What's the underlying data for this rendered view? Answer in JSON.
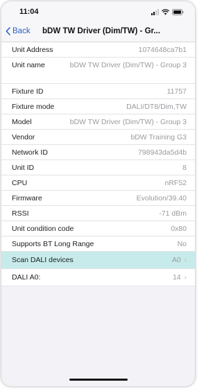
{
  "status": {
    "time": "11:04"
  },
  "nav": {
    "back_label": "Back",
    "title": "bDW TW Driver (Dim/TW) - Gr..."
  },
  "rows": [
    {
      "label": "Unit Address",
      "value": "1074648ca7b1"
    },
    {
      "label": "Unit name",
      "value": "bDW TW Driver (Dim/TW) - Group 3"
    },
    {
      "label": "Fixture ID",
      "value": "11757"
    },
    {
      "label": "Fixture mode",
      "value": "DALI/DT8/Dim,TW"
    },
    {
      "label": "Model",
      "value": "bDW TW Driver (Dim/TW) - Group 3"
    },
    {
      "label": "Vendor",
      "value": "bDW Training G3"
    },
    {
      "label": "Network ID",
      "value": "798943da5d4b"
    },
    {
      "label": "Unit ID",
      "value": "8"
    },
    {
      "label": "CPU",
      "value": "nRF52"
    },
    {
      "label": "Firmware",
      "value": "Evolution/39.40"
    },
    {
      "label": "RSSI",
      "value": "-71 dBm"
    },
    {
      "label": "Unit condition code",
      "value": "0x80"
    },
    {
      "label": "Supports BT Long Range",
      "value": "No"
    }
  ],
  "actions": [
    {
      "label": "Scan DALI devices",
      "value": "A0"
    },
    {
      "label": "DALI A0:",
      "value": "14"
    }
  ],
  "colors": {
    "accent": "#2f5fc4",
    "highlight_row": "#c7ebea",
    "background": "#f2f2f7"
  }
}
